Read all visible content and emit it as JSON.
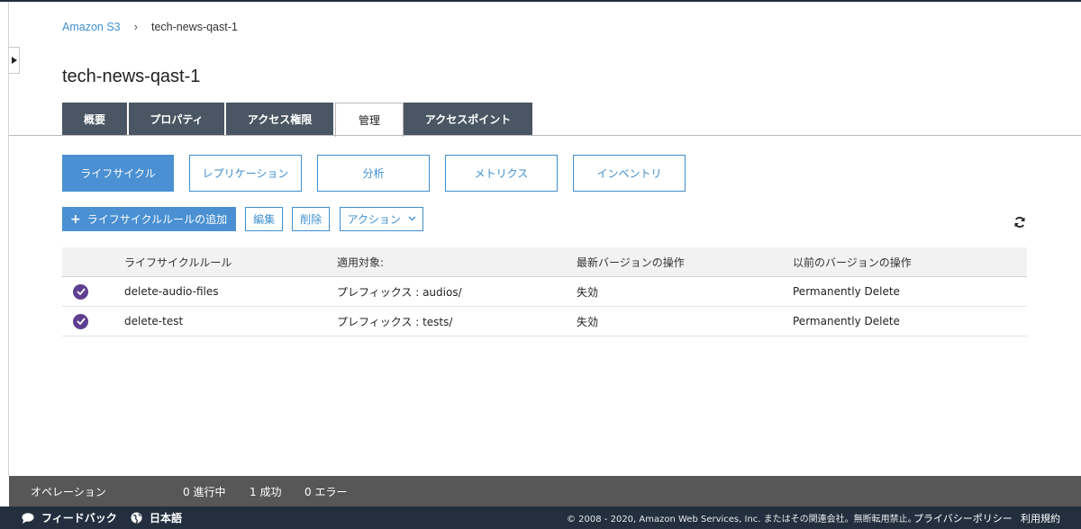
{
  "breadcrumb": {
    "root": "Amazon S3",
    "separator": "›",
    "current": "tech-news-qast-1"
  },
  "page_title": "tech-news-qast-1",
  "tabs": [
    {
      "label": "概要",
      "active": false
    },
    {
      "label": "プロパティ",
      "active": false
    },
    {
      "label": "アクセス権限",
      "active": false
    },
    {
      "label": "管理",
      "active": true
    },
    {
      "label": "アクセスポイント",
      "active": false
    }
  ],
  "subtabs": [
    {
      "label": "ライフサイクル",
      "active": true
    },
    {
      "label": "レプリケーション",
      "active": false
    },
    {
      "label": "分析",
      "active": false
    },
    {
      "label": "メトリクス",
      "active": false
    },
    {
      "label": "インベントリ",
      "active": false
    }
  ],
  "toolbar": {
    "add_icon": "+",
    "add_label": "ライフサイクルルールの追加",
    "edit_label": "編集",
    "delete_label": "削除",
    "actions_label": "アクション",
    "refresh_icon": "refresh-icon"
  },
  "table": {
    "headers": [
      "ライフサイクルルール",
      "適用対象:",
      "最新バージョンの操作",
      "以前のバージョンの操作"
    ],
    "rows": [
      {
        "status_icon": "check-circle-icon",
        "rule": "delete-audio-files",
        "target": "プレフィックス : audios/",
        "current_action": "失効",
        "previous_action": "Permanently Delete"
      },
      {
        "status_icon": "check-circle-icon",
        "rule": "delete-test",
        "target": "プレフィックス : tests/",
        "current_action": "失効",
        "previous_action": "Permanently Delete"
      }
    ]
  },
  "operations": {
    "label": "オペレーション",
    "in_progress": "0 進行中",
    "success": "1 成功",
    "errors": "0 エラー"
  },
  "footer": {
    "feedback": "フィードバック",
    "language": "日本語",
    "copyright": "© 2008 - 2020, Amazon Web Services, Inc. またはその関連会社。無断転用禁止。",
    "privacy": "プライバシーポリシー",
    "terms": "利用規約"
  },
  "colors": {
    "accent": "#4a90d2",
    "tab_dark": "#4a5663",
    "status_purple": "#5f3f8f",
    "footer_bg": "#232f3e",
    "ops_bg": "#575757"
  }
}
